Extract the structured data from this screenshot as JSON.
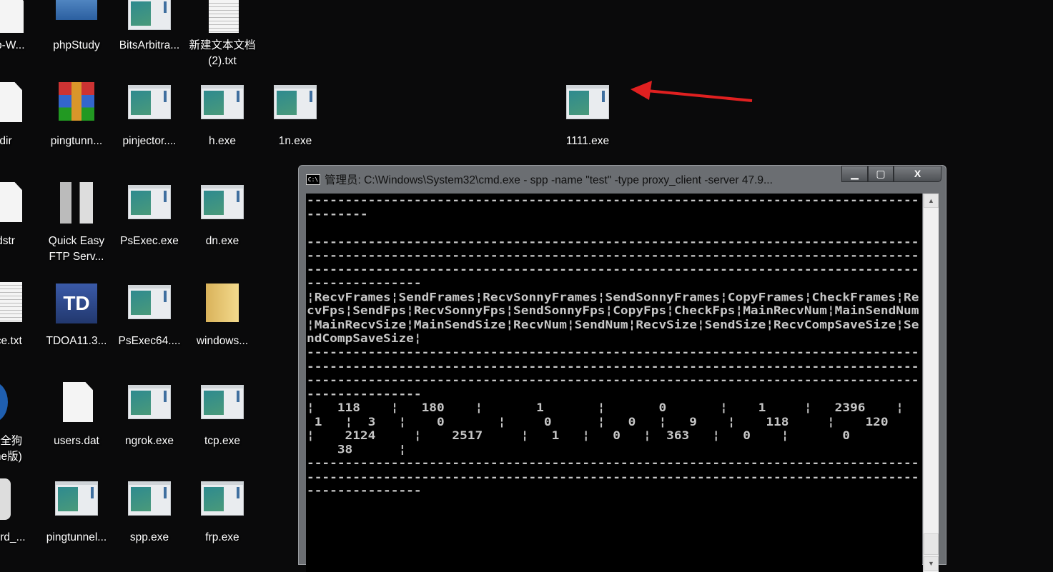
{
  "desktop": {
    "icons": [
      {
        "label": "ap-W...",
        "type": "shield-app"
      },
      {
        "label": "phpStudy",
        "type": "shortcut"
      },
      {
        "label": "BitsArbitra...",
        "type": "exe"
      },
      {
        "label": "新建文本文档\n(2).txt",
        "type": "txt"
      },
      {
        "label": "dir",
        "type": "doc"
      },
      {
        "label": "pingtunn...",
        "type": "rar"
      },
      {
        "label": "pinjector....",
        "type": "exe"
      },
      {
        "label": "h.exe",
        "type": "exe"
      },
      {
        "label": "1n.exe",
        "type": "exe"
      },
      {
        "label": "1111.exe",
        "type": "exe"
      },
      {
        "label": "dstr",
        "type": "doc"
      },
      {
        "label": "Quick Easy\nFTP Serv...",
        "type": "ftp"
      },
      {
        "label": "PsExec.exe",
        "type": "exe"
      },
      {
        "label": "dn.exe",
        "type": "exe"
      },
      {
        "label": "ace.txt",
        "type": "txt"
      },
      {
        "label": "TDOA11.3...",
        "type": "tdoa"
      },
      {
        "label": "PsExec64....",
        "type": "exe"
      },
      {
        "label": "windows...",
        "type": "folder"
      },
      {
        "label": "安全狗\nche版)",
        "type": "shield"
      },
      {
        "label": "users.dat",
        "type": "doc"
      },
      {
        "label": "ngrok.exe",
        "type": "exe"
      },
      {
        "label": "tcp.exe",
        "type": "exe"
      },
      {
        "label": "word_...",
        "type": "key"
      },
      {
        "label": "pingtunnel...",
        "type": "exe"
      },
      {
        "label": "spp.exe",
        "type": "exe"
      },
      {
        "label": "frp.exe",
        "type": "exe"
      }
    ],
    "annotation_color": "#e02020",
    "tdoa_glyph": "TD",
    "shield_glyph": "e"
  },
  "window": {
    "title": "管理员: C:\\Windows\\System32\\cmd.exe - spp  -name \"test\" -type proxy_client -server 47.9...",
    "icon_text": "C:\\",
    "min": "▁",
    "max": "▢",
    "close": "X",
    "scroll_up": "▲",
    "scroll_down": "▼",
    "lines": [
      "--------------------------------------------------------------------------------",
      "--------",
      "",
      "--------------------------------------------------------------------------------",
      "--------------------------------------------------------------------------------",
      "--------------------------------------------------------------------------------",
      "---------------",
      "¦RecvFrames¦SendFrames¦RecvSonnyFrames¦SendSonnyFrames¦CopyFrames¦CheckFrames¦Re",
      "cvFps¦SendFps¦RecvSonnyFps¦SendSonnyFps¦CopyFps¦CheckFps¦MainRecvNum¦MainSendNum",
      "¦MainRecvSize¦MainSendSize¦RecvNum¦SendNum¦RecvSize¦SendSize¦RecvCompSaveSize¦Se",
      "ndCompSaveSize¦",
      "--------------------------------------------------------------------------------",
      "--------------------------------------------------------------------------------",
      "--------------------------------------------------------------------------------",
      "---------------",
      "¦   118    ¦   180    ¦       1       ¦       0       ¦    1     ¦   2396    ¦",
      " 1   ¦  3   ¦    0       ¦     0      ¦   0   ¦   9    ¦    118     ¦    120",
      "¦    2124     ¦    2517     ¦   1   ¦   0   ¦  363   ¦   0    ¦       0          ¦",
      "    38      ¦",
      "--------------------------------------------------------------------------------",
      "--------------------------------------------------------------------------------",
      "---------------"
    ]
  }
}
